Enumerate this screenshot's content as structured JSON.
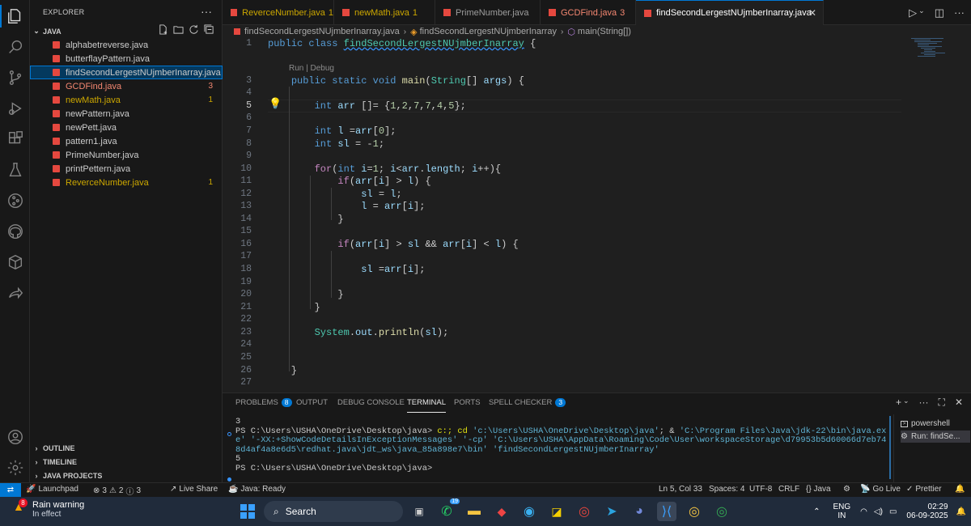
{
  "explorer": {
    "title": "EXPLORER",
    "folder": "JAVA",
    "files": [
      {
        "name": "alphabetreverse.java",
        "status": "normal",
        "badge": ""
      },
      {
        "name": "butterflayPattern.java",
        "status": "normal",
        "badge": ""
      },
      {
        "name": "findSecondLergestNUjmberInarray.java",
        "status": "selected",
        "badge": ""
      },
      {
        "name": "GCDFind.java",
        "status": "error",
        "badge": "3"
      },
      {
        "name": "newMath.java",
        "status": "warning",
        "badge": "1"
      },
      {
        "name": "newPattern.java",
        "status": "normal",
        "badge": ""
      },
      {
        "name": "newPett.java",
        "status": "normal",
        "badge": ""
      },
      {
        "name": "pattern1.java",
        "status": "normal",
        "badge": ""
      },
      {
        "name": "PrimeNumber.java",
        "status": "normal",
        "badge": ""
      },
      {
        "name": "printPettern.java",
        "status": "normal",
        "badge": ""
      },
      {
        "name": "ReverceNumber.java",
        "status": "warning",
        "badge": "1"
      }
    ],
    "sections": [
      "OUTLINE",
      "TIMELINE",
      "JAVA PROJECTS"
    ]
  },
  "tabs": [
    {
      "label": "ReverceNumber.java",
      "count": "1",
      "status": "warning"
    },
    {
      "label": "newMath.java",
      "count": "1",
      "status": "warning"
    },
    {
      "label": "PrimeNumber.java",
      "count": "",
      "status": "normal"
    },
    {
      "label": "GCDFind.java",
      "count": "3",
      "status": "error"
    },
    {
      "label": "findSecondLergestNUjmberInarray.java",
      "count": "",
      "status": "active"
    }
  ],
  "breadcrumb": {
    "file": "findSecondLergestNUjmberInarray.java",
    "class": "findSecondLergestNUjmberInarray",
    "method": "main(String[])"
  },
  "editor": {
    "codelens": "Run | Debug",
    "line_numbers": [
      "1",
      "3",
      "4",
      "5",
      "6",
      "7",
      "8",
      "9",
      "10",
      "11",
      "12",
      "13",
      "14",
      "15",
      "16",
      "17",
      "18",
      "19",
      "20",
      "21",
      "22",
      "23",
      "24",
      "25",
      "26",
      "27"
    ],
    "current_line": "5"
  },
  "panel": {
    "tabs": [
      {
        "label": "PROBLEMS",
        "badge": "8"
      },
      {
        "label": "OUTPUT",
        "badge": ""
      },
      {
        "label": "DEBUG CONSOLE",
        "badge": ""
      },
      {
        "label": "TERMINAL",
        "badge": ""
      },
      {
        "label": "PORTS",
        "badge": ""
      },
      {
        "label": "SPELL CHECKER",
        "badge": "3"
      }
    ],
    "active_tab": "TERMINAL",
    "terminal": {
      "line1": "3",
      "prompt": "PS C:\\Users\\USHA\\OneDrive\\Desktop\\java> ",
      "cmd_a": "c:; cd ",
      "str_a": "'c:\\Users\\USHA\\OneDrive\\Desktop\\java'",
      "cmd_b": "; & ",
      "str_b": "'C:\\Program Files\\Java\\jdk-22\\bin\\java.exe'",
      "str_c": " '-XX:+ShowCodeDetailsInExceptionMessages' '-cp' 'C:\\Users\\USHA\\AppData\\Roaming\\Code\\User\\workspaceStorage\\d79953b5d60066d7eb748d4af4a8e6d5\\redhat.java\\jdt_ws\\java_85a898e7\\bin' 'findSecondLergestNUjmberInarray'",
      "output": "5",
      "prompt2": "PS C:\\Users\\USHA\\OneDrive\\Desktop\\java> "
    },
    "terminal_list": [
      "powershell",
      "Run: findSe..."
    ]
  },
  "statusbar": {
    "launchpad": "Launchpad",
    "errors": "3",
    "warnings": "2",
    "info": "3",
    "live_share": "Live Share",
    "java_status": "Java: Ready",
    "cursor": "Ln 5, Col 33",
    "spaces": "Spaces: 4",
    "encoding": "UTF-8",
    "eol": "CRLF",
    "language": "{} Java",
    "go_live": "Go Live",
    "prettier": "Prettier"
  },
  "taskbar": {
    "weather_title": "Rain warning",
    "weather_sub": "In effect",
    "weather_badge": "8",
    "search": "Search",
    "whatsapp_badge": "19",
    "lang_top": "ENG",
    "lang_bottom": "IN",
    "time": "02:29",
    "date": "06-09-2025"
  },
  "colors": {
    "accent": "#0078d4",
    "error": "#f48771",
    "warning": "#cca700",
    "editor_bg": "#1f1f1f"
  }
}
